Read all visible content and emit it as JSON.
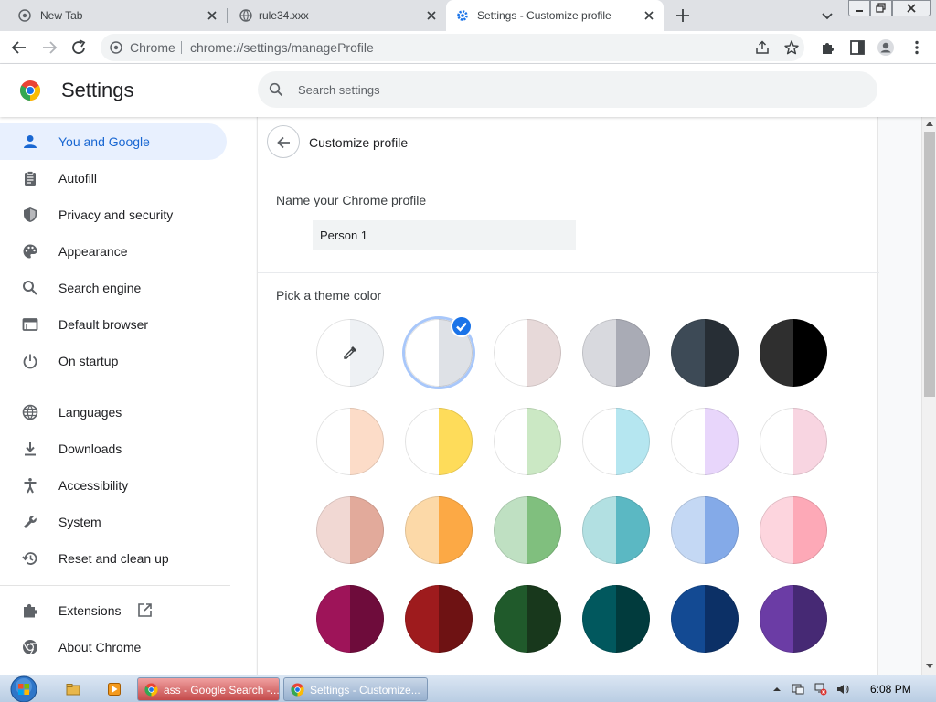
{
  "tabs": [
    {
      "title": "New Tab"
    },
    {
      "title": "rule34.xxx"
    },
    {
      "title": "Settings - Customize profile"
    }
  ],
  "omnibox": {
    "site_label": "Chrome",
    "url": "chrome://settings/manageProfile"
  },
  "settings": {
    "title": "Settings",
    "search_placeholder": "Search settings"
  },
  "sidebar": {
    "items": [
      {
        "label": "You and Google",
        "icon": "person-icon",
        "active": true
      },
      {
        "label": "Autofill",
        "icon": "clipboard-icon"
      },
      {
        "label": "Privacy and security",
        "icon": "shield-icon"
      },
      {
        "label": "Appearance",
        "icon": "palette-icon"
      },
      {
        "label": "Search engine",
        "icon": "search-icon"
      },
      {
        "label": "Default browser",
        "icon": "browser-window-icon"
      },
      {
        "label": "On startup",
        "icon": "power-icon"
      },
      {
        "label": "Languages",
        "icon": "globe-icon"
      },
      {
        "label": "Downloads",
        "icon": "download-icon"
      },
      {
        "label": "Accessibility",
        "icon": "accessibility-icon"
      },
      {
        "label": "System",
        "icon": "wrench-icon"
      },
      {
        "label": "Reset and clean up",
        "icon": "history-icon"
      },
      {
        "label": "Extensions",
        "icon": "puzzle-icon"
      },
      {
        "label": "About Chrome",
        "icon": "chrome-icon"
      }
    ]
  },
  "customize_profile": {
    "title": "Customize profile",
    "name_label": "Name your Chrome profile",
    "name_value": "Person 1",
    "theme_label": "Pick a theme color",
    "selected_index": 1,
    "theme_colors": [
      {
        "left": "#ffffff",
        "right": "#eef1f4",
        "custom": true
      },
      {
        "left": "#ffffff",
        "right": "#dee1e6"
      },
      {
        "left": "#ffffff",
        "right": "#e7d9d9"
      },
      {
        "left": "#d8d9de",
        "right": "#a9abb5"
      },
      {
        "left": "#3d4a56",
        "right": "#272e35"
      },
      {
        "left": "#2f2f2f",
        "right": "#000000"
      },
      {
        "left": "#ffffff",
        "right": "#fcdcc8"
      },
      {
        "left": "#ffffff",
        "right": "#fedc5a"
      },
      {
        "left": "#ffffff",
        "right": "#cbe8c4"
      },
      {
        "left": "#ffffff",
        "right": "#b5e6f0"
      },
      {
        "left": "#ffffff",
        "right": "#e8d6fb"
      },
      {
        "left": "#ffffff",
        "right": "#f8d5e1"
      },
      {
        "left": "#f1d8d3",
        "right": "#e2aa9b"
      },
      {
        "left": "#fcd9a8",
        "right": "#fca945"
      },
      {
        "left": "#bfe0c2",
        "right": "#80bf7e"
      },
      {
        "left": "#b2e0e2",
        "right": "#5bb8c3"
      },
      {
        "left": "#c4d8f4",
        "right": "#84aae8"
      },
      {
        "left": "#fdd5de",
        "right": "#fda9b7"
      },
      {
        "left": "#9e1459",
        "right": "#6e0c3b"
      },
      {
        "left": "#9e1b1d",
        "right": "#6e1213"
      },
      {
        "left": "#205a2b",
        "right": "#18381c"
      },
      {
        "left": "#01585e",
        "right": "#013b3d"
      },
      {
        "left": "#134a93",
        "right": "#0c3066"
      },
      {
        "left": "#6b3ca5",
        "right": "#462974"
      }
    ]
  },
  "taskbar": {
    "buttons": [
      {
        "label": "ass - Google Search -..."
      },
      {
        "label": "Settings - Customize..."
      }
    ],
    "clock": "6:08 PM"
  },
  "colors": {
    "accent": "#1a73e8",
    "active_nav_bg": "#e8f0fe",
    "active_nav_text": "#1967d2"
  }
}
